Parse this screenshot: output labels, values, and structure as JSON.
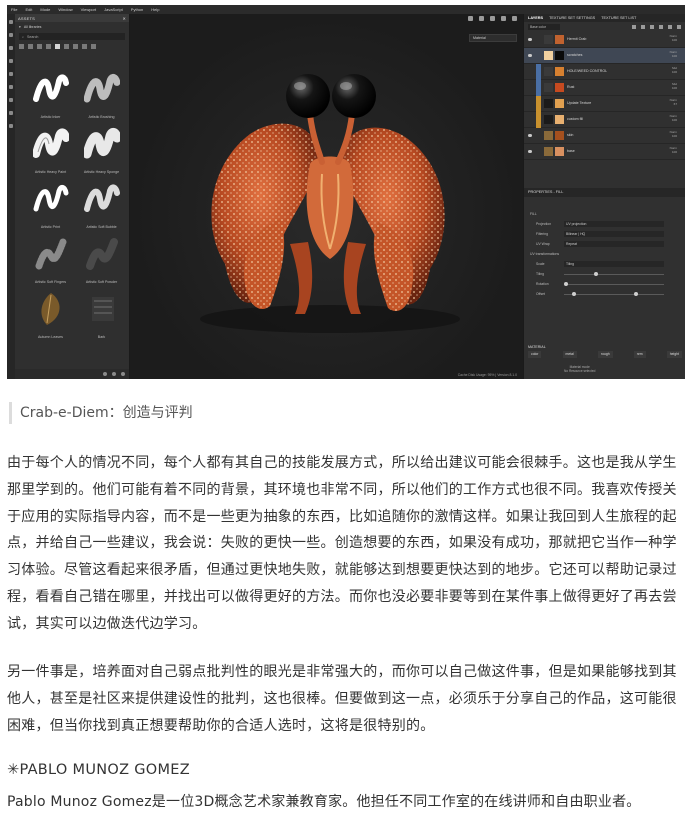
{
  "app": {
    "menu": [
      "File",
      "Edit",
      "Mode",
      "Window",
      "Viewport",
      "JavaScript",
      "Python",
      "Help"
    ],
    "assets_panel": {
      "title": "ASSETS",
      "library": "All libraries",
      "search_placeholder": "Search",
      "brushes": [
        {
          "name": "Artistic Inker"
        },
        {
          "name": "Artistic Brushing"
        },
        {
          "name": "Artistic Heavy Paint"
        },
        {
          "name": "Artistic Heavy Sponge"
        },
        {
          "name": "Artistic Print"
        },
        {
          "name": "Artistic Soft Bubble"
        },
        {
          "name": "Artistic Soft Fingers"
        },
        {
          "name": "Artistic Soft Powder"
        },
        {
          "name": "Autumn Leaves"
        },
        {
          "name": "Bark"
        }
      ]
    },
    "viewport": {
      "display_mode": "Material",
      "footer": "Cache Disk Usage:  95% | Version 8.1.0"
    },
    "layers_panel": {
      "tabs": [
        "LAYERS",
        "TEXTURE SET SETTINGS",
        "TEXTURE SET LIST"
      ],
      "channel": "Base color",
      "layers": [
        {
          "name": "Hermit Crab",
          "blend": "Norm",
          "opacity": "100",
          "color": "#c0622f"
        },
        {
          "name": "scratches",
          "blend": "Norm",
          "opacity": "100",
          "color": "#f0d0a0",
          "selected": true
        },
        {
          "name": "HOLE/WEED CONTROL",
          "blend": "Mul",
          "opacity": "100",
          "color": "#d68030"
        },
        {
          "name": "Rust",
          "blend": "Mul",
          "opacity": "100",
          "color": "#c64a20"
        },
        {
          "name": "Update Texture",
          "blend": "Norm",
          "opacity": "67",
          "color": "#e0a050"
        },
        {
          "name": "custom fill",
          "blend": "Norm",
          "opacity": "100",
          "color": "#e8b070"
        },
        {
          "name": "skin",
          "blend": "Norm",
          "opacity": "100",
          "color": "#a5501e"
        },
        {
          "name": "base",
          "blend": "Norm",
          "opacity": "100",
          "color": "#d89060"
        }
      ]
    },
    "properties_panel": {
      "title": "PROPERTIES - FILL",
      "section": "FILL",
      "rows": [
        {
          "key": "Projection",
          "value": "UV projection"
        },
        {
          "key": "Filtering",
          "value": "Bilinear | HQ"
        },
        {
          "key": "UV Wrap",
          "value": "Repeat"
        }
      ],
      "uv_header": "UV transformations",
      "scale_label": "Scale",
      "scale_value": "Tiling",
      "tiling_label": "Tiling",
      "rotation_label": "Rotation",
      "offset_label": "Offset",
      "material_header": "MATERIAL",
      "material_channels": [
        "color",
        "metal",
        "rough",
        "nrm",
        "height"
      ],
      "material_note": "Material mode\nNo Resource selected"
    }
  },
  "caption": "Crab-e-Diem：创造与评判",
  "paragraphs": [
    "由于每个人的情况不同，每个人都有其自己的技能发展方式，所以给出建议可能会很棘手。这也是我从学生那里学到的。他们可能有着不同的背景，其环境也非常不同，所以他们的工作方式也很不同。我喜欢传授关于应用的实际指导内容，而不是一些更为抽象的东西，比如追随你的激情这样。如果让我回到人生旅程的起点，并给自己一些建议，我会说：失败的更快一些。创造想要的东西，如果没有成功，那就把它当作一种学习体验。尽管这看起来很矛盾，但通过更快地失败，就能够达到想要更快达到的地步。它还可以帮助记录过程，看看自己错在哪里，并找出可以做得更好的方法。而你也没必要非要等到在某件事上做得更好了再去尝试，其实可以边做迭代边学习。",
    "另一件事是，培养面对自己弱点批判性的眼光是非常强大的，而你可以自己做这件事，但是如果能够找到其他人，甚至是社区来提供建设性的批判，这也很棒。但要做到这一点，必须乐于分享自己的作品，这可能很困难，但当你找到真正想要帮助你的合适人选时，这将是很特别的。"
  ],
  "author": "✳PABLO MUNOZ GOMEZ",
  "bio": "Pablo Munoz Gomez是一位3D概念艺术家兼教育家。他担任不同工作室的在线讲师和自由职业者。"
}
